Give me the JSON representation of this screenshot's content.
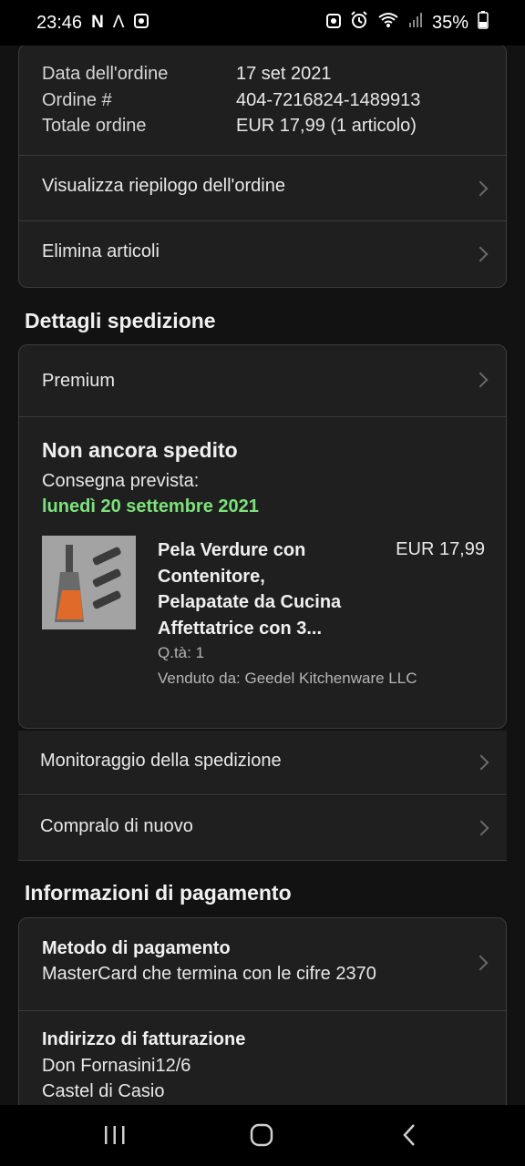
{
  "status_bar": {
    "time": "23:46",
    "battery": "35%",
    "left_icons": [
      "n-icon",
      "lambda-icon",
      "app-icon"
    ],
    "right_icons": [
      "screenshot-icon",
      "alarm-icon",
      "wifi-icon",
      "signal-icon",
      "battery-icon"
    ]
  },
  "order_summary": {
    "rows": [
      {
        "label": "Data dell'ordine",
        "value": "17 set 2021"
      },
      {
        "label": "Ordine #",
        "value": "404-7216824-1489913"
      },
      {
        "label": "Totale ordine",
        "value": "EUR 17,99 (1 articolo)"
      }
    ],
    "view_summary": "Visualizza riepilogo dell'ordine",
    "delete_items": "Elimina articoli"
  },
  "shipping": {
    "section_title": "Dettagli spedizione",
    "service": "Premium",
    "status": "Non ancora spedito",
    "delivery_label": "Consegna prevista:",
    "delivery_date": "lunedì 20 settembre 2021",
    "product": {
      "title_lines": [
        "Pela Verdure con",
        "Contenitore,",
        "Pelapatate da Cucina",
        "Affettatrice con 3..."
      ],
      "price": "EUR 17,99",
      "quantity": "Q.tà: 1",
      "seller": "Venduto da: Geedel Kitchenware LLC"
    },
    "track": "Monitoraggio della spedizione",
    "buy_again": "Compralo di nuovo"
  },
  "payment": {
    "section_title": "Informazioni di pagamento",
    "method_title": "Metodo di pagamento",
    "method_value": "MasterCard che termina con le cifre 2370",
    "billing_title": "Indirizzo di fatturazione",
    "billing_lines": [
      "Don Fornasini12/6",
      "Castel di Casio"
    ]
  },
  "colors": {
    "accent_green": "#7be27b",
    "background": "#121212",
    "card": "#1f1f1f"
  }
}
